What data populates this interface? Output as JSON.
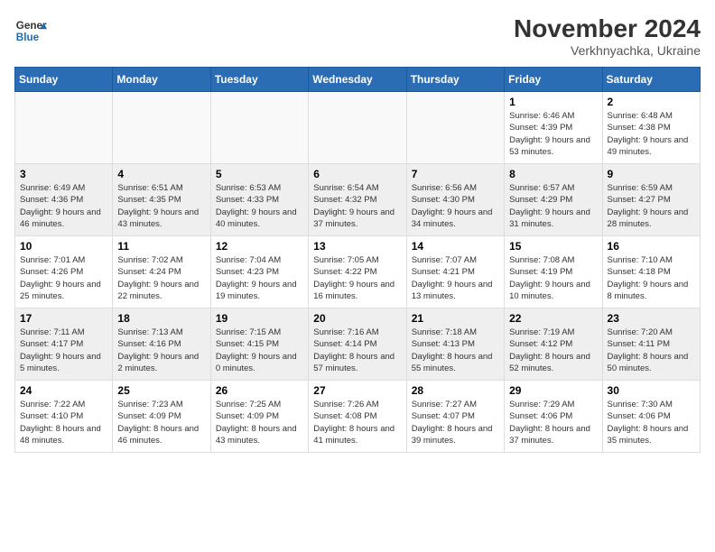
{
  "logo": {
    "text_general": "General",
    "text_blue": "Blue"
  },
  "header": {
    "month_year": "November 2024",
    "location": "Verkhnyachka, Ukraine"
  },
  "weekdays": [
    "Sunday",
    "Monday",
    "Tuesday",
    "Wednesday",
    "Thursday",
    "Friday",
    "Saturday"
  ],
  "weeks": [
    [
      {
        "day": "",
        "info": ""
      },
      {
        "day": "",
        "info": ""
      },
      {
        "day": "",
        "info": ""
      },
      {
        "day": "",
        "info": ""
      },
      {
        "day": "",
        "info": ""
      },
      {
        "day": "1",
        "info": "Sunrise: 6:46 AM\nSunset: 4:39 PM\nDaylight: 9 hours and 53 minutes."
      },
      {
        "day": "2",
        "info": "Sunrise: 6:48 AM\nSunset: 4:38 PM\nDaylight: 9 hours and 49 minutes."
      }
    ],
    [
      {
        "day": "3",
        "info": "Sunrise: 6:49 AM\nSunset: 4:36 PM\nDaylight: 9 hours and 46 minutes."
      },
      {
        "day": "4",
        "info": "Sunrise: 6:51 AM\nSunset: 4:35 PM\nDaylight: 9 hours and 43 minutes."
      },
      {
        "day": "5",
        "info": "Sunrise: 6:53 AM\nSunset: 4:33 PM\nDaylight: 9 hours and 40 minutes."
      },
      {
        "day": "6",
        "info": "Sunrise: 6:54 AM\nSunset: 4:32 PM\nDaylight: 9 hours and 37 minutes."
      },
      {
        "day": "7",
        "info": "Sunrise: 6:56 AM\nSunset: 4:30 PM\nDaylight: 9 hours and 34 minutes."
      },
      {
        "day": "8",
        "info": "Sunrise: 6:57 AM\nSunset: 4:29 PM\nDaylight: 9 hours and 31 minutes."
      },
      {
        "day": "9",
        "info": "Sunrise: 6:59 AM\nSunset: 4:27 PM\nDaylight: 9 hours and 28 minutes."
      }
    ],
    [
      {
        "day": "10",
        "info": "Sunrise: 7:01 AM\nSunset: 4:26 PM\nDaylight: 9 hours and 25 minutes."
      },
      {
        "day": "11",
        "info": "Sunrise: 7:02 AM\nSunset: 4:24 PM\nDaylight: 9 hours and 22 minutes."
      },
      {
        "day": "12",
        "info": "Sunrise: 7:04 AM\nSunset: 4:23 PM\nDaylight: 9 hours and 19 minutes."
      },
      {
        "day": "13",
        "info": "Sunrise: 7:05 AM\nSunset: 4:22 PM\nDaylight: 9 hours and 16 minutes."
      },
      {
        "day": "14",
        "info": "Sunrise: 7:07 AM\nSunset: 4:21 PM\nDaylight: 9 hours and 13 minutes."
      },
      {
        "day": "15",
        "info": "Sunrise: 7:08 AM\nSunset: 4:19 PM\nDaylight: 9 hours and 10 minutes."
      },
      {
        "day": "16",
        "info": "Sunrise: 7:10 AM\nSunset: 4:18 PM\nDaylight: 9 hours and 8 minutes."
      }
    ],
    [
      {
        "day": "17",
        "info": "Sunrise: 7:11 AM\nSunset: 4:17 PM\nDaylight: 9 hours and 5 minutes."
      },
      {
        "day": "18",
        "info": "Sunrise: 7:13 AM\nSunset: 4:16 PM\nDaylight: 9 hours and 2 minutes."
      },
      {
        "day": "19",
        "info": "Sunrise: 7:15 AM\nSunset: 4:15 PM\nDaylight: 9 hours and 0 minutes."
      },
      {
        "day": "20",
        "info": "Sunrise: 7:16 AM\nSunset: 4:14 PM\nDaylight: 8 hours and 57 minutes."
      },
      {
        "day": "21",
        "info": "Sunrise: 7:18 AM\nSunset: 4:13 PM\nDaylight: 8 hours and 55 minutes."
      },
      {
        "day": "22",
        "info": "Sunrise: 7:19 AM\nSunset: 4:12 PM\nDaylight: 8 hours and 52 minutes."
      },
      {
        "day": "23",
        "info": "Sunrise: 7:20 AM\nSunset: 4:11 PM\nDaylight: 8 hours and 50 minutes."
      }
    ],
    [
      {
        "day": "24",
        "info": "Sunrise: 7:22 AM\nSunset: 4:10 PM\nDaylight: 8 hours and 48 minutes."
      },
      {
        "day": "25",
        "info": "Sunrise: 7:23 AM\nSunset: 4:09 PM\nDaylight: 8 hours and 46 minutes."
      },
      {
        "day": "26",
        "info": "Sunrise: 7:25 AM\nSunset: 4:09 PM\nDaylight: 8 hours and 43 minutes."
      },
      {
        "day": "27",
        "info": "Sunrise: 7:26 AM\nSunset: 4:08 PM\nDaylight: 8 hours and 41 minutes."
      },
      {
        "day": "28",
        "info": "Sunrise: 7:27 AM\nSunset: 4:07 PM\nDaylight: 8 hours and 39 minutes."
      },
      {
        "day": "29",
        "info": "Sunrise: 7:29 AM\nSunset: 4:06 PM\nDaylight: 8 hours and 37 minutes."
      },
      {
        "day": "30",
        "info": "Sunrise: 7:30 AM\nSunset: 4:06 PM\nDaylight: 8 hours and 35 minutes."
      }
    ]
  ]
}
